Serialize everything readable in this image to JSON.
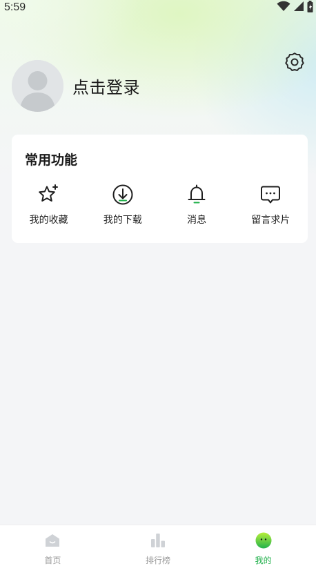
{
  "status_bar": {
    "time": "5:59",
    "icons": [
      "wifi-icon",
      "signal-icon",
      "battery-icon"
    ]
  },
  "header": {
    "settings_icon": "gear-icon"
  },
  "profile": {
    "avatar_icon": "default-avatar-icon",
    "login_text": "点击登录"
  },
  "functions": {
    "title": "常用功能",
    "items": [
      {
        "label": "我的收藏",
        "icon": "star-sparkle-icon"
      },
      {
        "label": "我的下载",
        "icon": "download-circle-icon"
      },
      {
        "label": "消息",
        "icon": "bell-icon"
      },
      {
        "label": "留言求片",
        "icon": "chat-bubble-icon"
      }
    ]
  },
  "bottom_nav": {
    "items": [
      {
        "label": "首页",
        "icon": "home-icon",
        "active": false
      },
      {
        "label": "排行榜",
        "icon": "bar-chart-icon",
        "active": false
      },
      {
        "label": "我的",
        "icon": "smiley-face-icon",
        "active": true
      }
    ]
  },
  "colors": {
    "accent": "#22b14c",
    "inactive_nav": "#c9ccd0",
    "card_bg": "#ffffff",
    "page_bg": "#f4f5f7"
  }
}
